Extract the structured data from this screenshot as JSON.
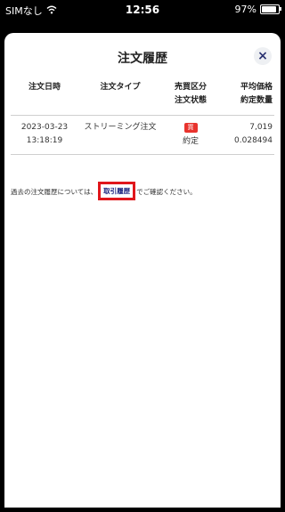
{
  "status_bar": {
    "carrier": "SIMなし",
    "time": "12:56",
    "battery": "97%",
    "battery_level": 0.97
  },
  "dialog": {
    "title": "注文履歴",
    "close_label": "×"
  },
  "table": {
    "headers": {
      "date": "注文日時",
      "type": "注文タイプ",
      "side_1": "売買区分",
      "side_2": "注文状態",
      "price_1": "平均価格",
      "price_2": "約定数量"
    },
    "rows": [
      {
        "date": "2023-03-23",
        "time": "13:18:19",
        "type": "ストリーミング注文",
        "side": "買",
        "status": "約定",
        "price": "7,019",
        "quantity": "0.028494"
      }
    ]
  },
  "note": {
    "prefix": "過去の注文履歴については、",
    "link": "取引履歴",
    "suffix": "でご確認ください。"
  },
  "colors": {
    "buy_badge": "#e8332d",
    "link": "#1a237e",
    "highlight": "#e0161b"
  }
}
